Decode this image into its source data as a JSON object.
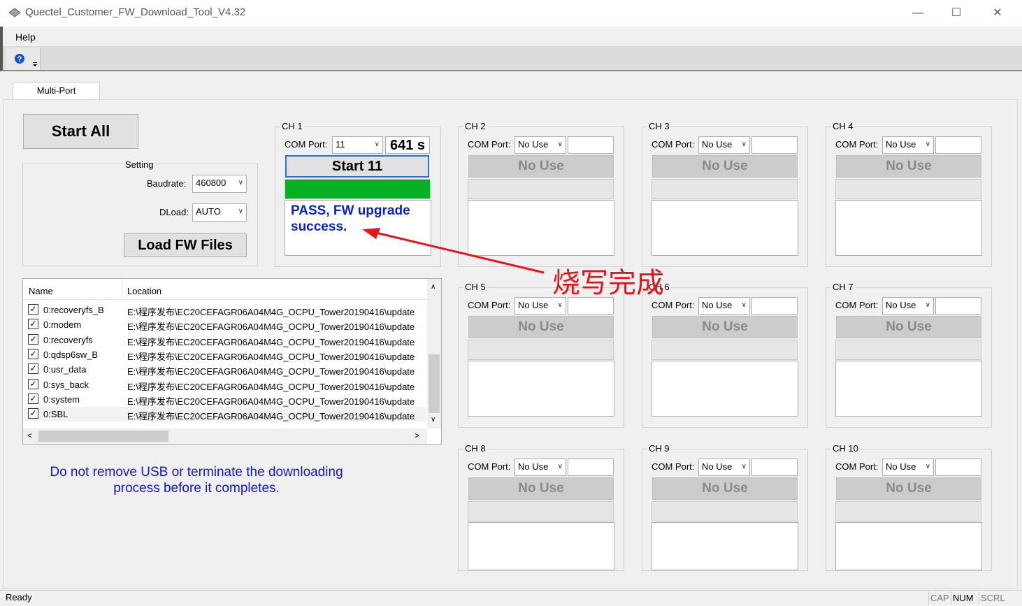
{
  "window": {
    "title": "Quectel_Customer_FW_Download_Tool_V4.32",
    "min": "—",
    "max": "☐",
    "close": "✕"
  },
  "menu": {
    "help": "Help"
  },
  "tabs": {
    "multiport": "Multi-Port"
  },
  "controls": {
    "start_all": "Start All",
    "setting_label": "Setting",
    "baudrate_label": "Baudrate:",
    "baudrate_value": "460800",
    "dload_label": "DLoad:",
    "dload_value": "AUTO",
    "load_fw": "Load FW Files"
  },
  "file_list": {
    "headers": [
      "Name",
      "Location"
    ],
    "rows": [
      {
        "name": "0:recoveryfs_B",
        "location": "E:\\程序发布\\EC20CEFAGR06A04M4G_OCPU_Tower20190416\\update"
      },
      {
        "name": "0:modem",
        "location": "E:\\程序发布\\EC20CEFAGR06A04M4G_OCPU_Tower20190416\\update"
      },
      {
        "name": "0:recoveryfs",
        "location": "E:\\程序发布\\EC20CEFAGR06A04M4G_OCPU_Tower20190416\\update"
      },
      {
        "name": "0:qdsp6sw_B",
        "location": "E:\\程序发布\\EC20CEFAGR06A04M4G_OCPU_Tower20190416\\update"
      },
      {
        "name": "0:usr_data",
        "location": "E:\\程序发布\\EC20CEFAGR06A04M4G_OCPU_Tower20190416\\update"
      },
      {
        "name": "0:sys_back",
        "location": "E:\\程序发布\\EC20CEFAGR06A04M4G_OCPU_Tower20190416\\update"
      },
      {
        "name": "0:system",
        "location": "E:\\程序发布\\EC20CEFAGR06A04M4G_OCPU_Tower20190416\\update"
      },
      {
        "name": "0:SBL",
        "location": "E:\\程序发布\\EC20CEFAGR06A04M4G_OCPU_Tower20190416\\update"
      }
    ]
  },
  "warning": {
    "line1": "Do not remove USB or terminate the downloading",
    "line2": "process before it completes."
  },
  "com_port_label": "COM Port:",
  "channels": [
    {
      "label": "CH 1",
      "port": "11",
      "time": "641 s",
      "button": "Start 11",
      "progress": 1.0,
      "message": "PASS, FW upgrade success."
    },
    {
      "label": "CH 2",
      "port": "No Use",
      "time": "",
      "button": "No Use",
      "progress": 0,
      "message": ""
    },
    {
      "label": "CH 3",
      "port": "No Use",
      "time": "",
      "button": "No Use",
      "progress": 0,
      "message": ""
    },
    {
      "label": "CH 4",
      "port": "No Use",
      "time": "",
      "button": "No Use",
      "progress": 0,
      "message": ""
    },
    {
      "label": "CH 5",
      "port": "No Use",
      "time": "",
      "button": "No Use",
      "progress": 0,
      "message": ""
    },
    {
      "label": "CH 6",
      "port": "No Use",
      "time": "",
      "button": "No Use",
      "progress": 0,
      "message": ""
    },
    {
      "label": "CH 7",
      "port": "No Use",
      "time": "",
      "button": "No Use",
      "progress": 0,
      "message": ""
    },
    {
      "label": "CH 8",
      "port": "No Use",
      "time": "",
      "button": "No Use",
      "progress": 0,
      "message": ""
    },
    {
      "label": "CH 9",
      "port": "No Use",
      "time": "",
      "button": "No Use",
      "progress": 0,
      "message": ""
    },
    {
      "label": "CH 10",
      "port": "No Use",
      "time": "",
      "button": "No Use",
      "progress": 0,
      "message": ""
    }
  ],
  "annotation": {
    "text": "烧写完成",
    "color": "#e8141b"
  },
  "colors": {
    "progress_fill": "#06b025",
    "message_text": "#0a22c8",
    "warning_text": "#1414c8"
  },
  "status": {
    "text": "Ready",
    "cap": "CAP",
    "num": "NUM",
    "scrl": "SCRL"
  }
}
